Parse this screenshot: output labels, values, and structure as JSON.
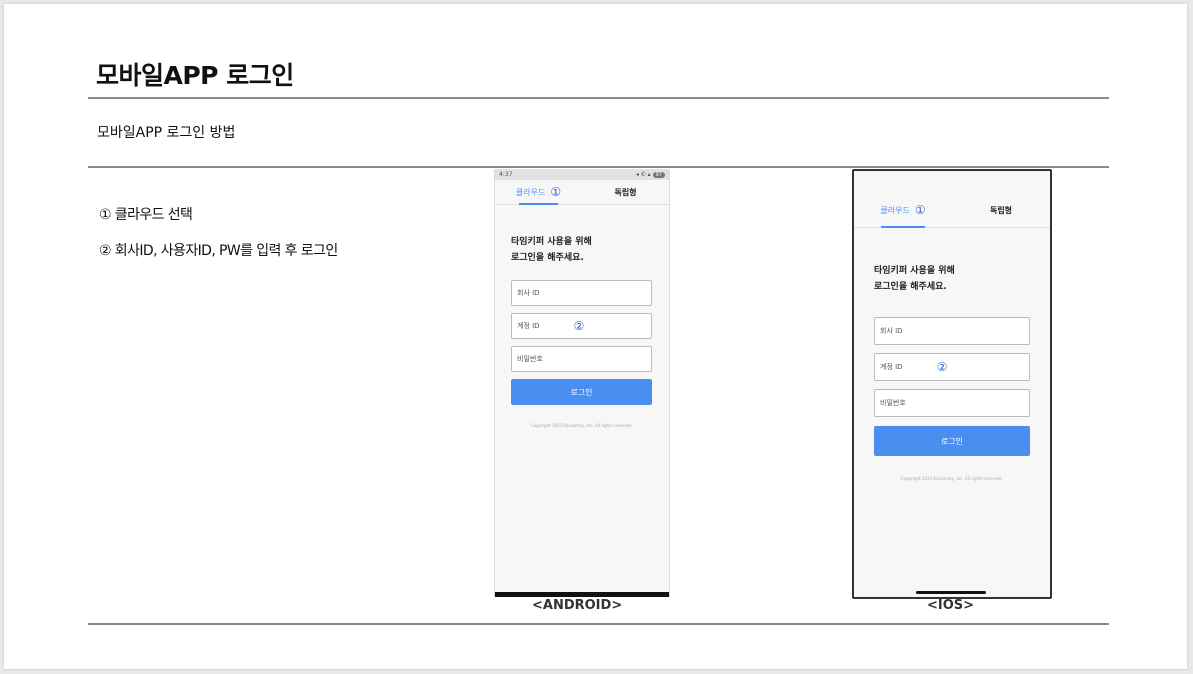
{
  "page": {
    "title": "모바일APP 로그인",
    "subtitle": "모바일APP 로그인 방법",
    "steps": [
      "① 클라우드 선택",
      "② 회사ID, 사용자ID, PW를 입력 후 로그인"
    ]
  },
  "android": {
    "status_time": "4:37",
    "status_icons": "◂ ✆ ▴",
    "status_badge": "97",
    "tabs": [
      "클라우드",
      "독립형"
    ],
    "tab_marker": "①",
    "heading_line1": "타임키퍼 사용을 위해",
    "heading_line2": "로그인을 해주세요.",
    "fields": [
      "회사 ID",
      "계정 ID",
      "비밀번호"
    ],
    "field_marker": "②",
    "login_label": "로그인",
    "copyright": "Copyright 2023 Rocusmay, Inc. All rights reserved.",
    "caption": "<ANDROID>"
  },
  "ios": {
    "tabs": [
      "클라우드",
      "독립형"
    ],
    "tab_marker": "①",
    "heading_line1": "타임키퍼 사용을 위해",
    "heading_line2": "로그인을 해주세요.",
    "fields": [
      "회사 ID",
      "계정 ID",
      "비밀번호"
    ],
    "field_marker": "②",
    "login_label": "로그인",
    "copyright": "Copyright 2023 Rocusmay, Inc. All rights reserved.",
    "caption": "<IOS>"
  },
  "colors": {
    "accent": "#4a8ff0",
    "marker": "#2f5fd0",
    "rule": "#8a8a8a"
  }
}
